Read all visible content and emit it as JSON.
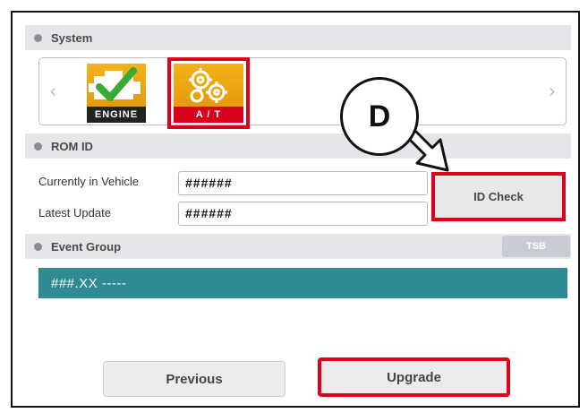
{
  "system": {
    "header": "System"
  },
  "modules": [
    {
      "caption": "ENGINE",
      "icon": "engine-check-icon"
    },
    {
      "caption": "A / T",
      "icon": "gears-icon",
      "selected": true
    }
  ],
  "rom_id": {
    "header": "ROM ID",
    "currently_label": "Currently in Vehicle",
    "currently_value": "######",
    "latest_label": "Latest Update",
    "latest_value": "######",
    "id_check_label": "ID Check"
  },
  "event_group": {
    "header": "Event Group",
    "tsb_label": "TSB",
    "selected_event": "###.XX -----"
  },
  "buttons": {
    "previous": "Previous",
    "upgrade": "Upgrade"
  },
  "callout": {
    "letter": "D"
  },
  "colors": {
    "highlight_red": "#e0001b",
    "teal": "#2f8a93",
    "header_gray": "#e6e6ea",
    "tile_gold": "#f3b319"
  }
}
